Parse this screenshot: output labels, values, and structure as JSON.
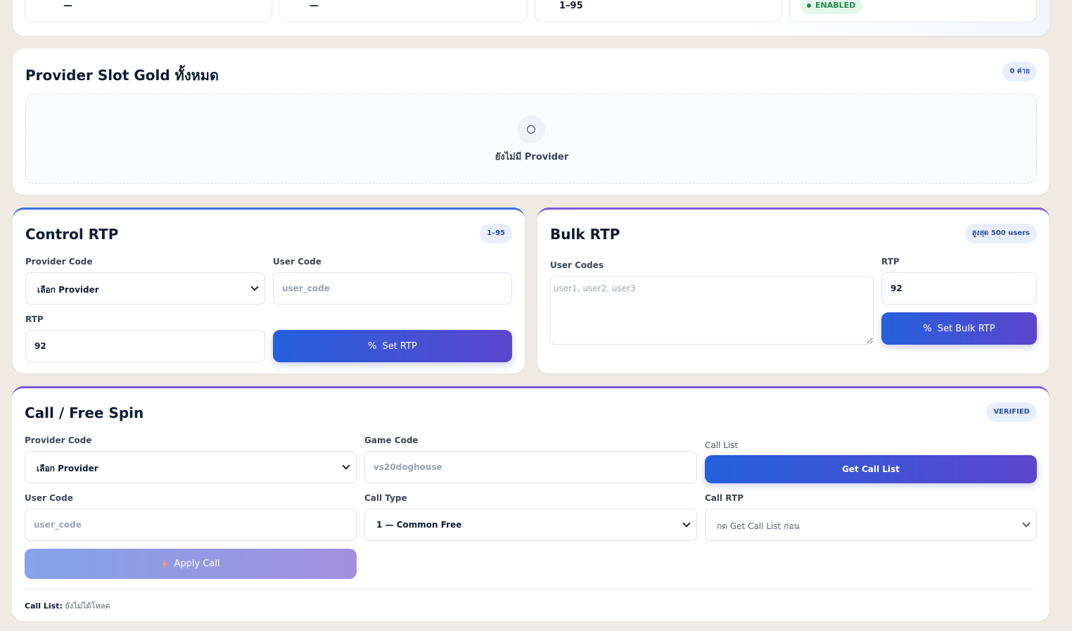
{
  "stats": [
    {
      "value": "—"
    },
    {
      "value": "—"
    },
    {
      "value": "1–95"
    },
    {
      "badge": "ENABLED"
    }
  ],
  "providers_card": {
    "title": "Provider Slot Gold ทั้งหมด",
    "count_badge": "0 ค่าย",
    "empty_text": "ยังไม่มี Provider",
    "empty_icon": "circle-icon"
  },
  "control_rtp": {
    "title": "Control RTP",
    "range_badge": "1–95",
    "provider_label": "Provider Code",
    "provider_selected": "เลือก Provider",
    "user_label": "User Code",
    "user_placeholder": "user_code",
    "rtp_label": "RTP",
    "rtp_value": "92",
    "button_icon": "%",
    "button_label": "Set RTP"
  },
  "bulk_rtp": {
    "title": "Bulk RTP",
    "limit_badge": "สูงสุด 500 users",
    "users_label": "User Codes",
    "users_placeholder": "user1, user2, user3",
    "rtp_label": "RTP",
    "rtp_value": "92",
    "button_icon": "%",
    "button_label": "Set Bulk RTP"
  },
  "call_free_spin": {
    "title": "Call / Free Spin",
    "status_badge": "VERIFIED",
    "provider_label": "Provider Code",
    "provider_selected": "เลือก Provider",
    "game_label": "Game Code",
    "game_placeholder": "vs20doghouse",
    "call_list_label": "Call List",
    "get_call_list_button": "Get Call List",
    "user_label": "User Code",
    "user_placeholder": "user_code",
    "call_type_label": "Call Type",
    "call_type_selected": "1 — Common Free",
    "call_rtp_label": "Call RTP",
    "call_rtp_selected": "กด Get Call List ก่อน",
    "apply_icon": "lightning-icon",
    "apply_button": "Apply Call",
    "footer_label": "Call List:",
    "footer_value": "ยังไม่ได้โหลด"
  },
  "colors": {
    "accent_blue": "#2460dd",
    "accent_purple": "#5b45cc",
    "enabled_green": "#1f8a4c",
    "page_bg": "#efebe4"
  }
}
